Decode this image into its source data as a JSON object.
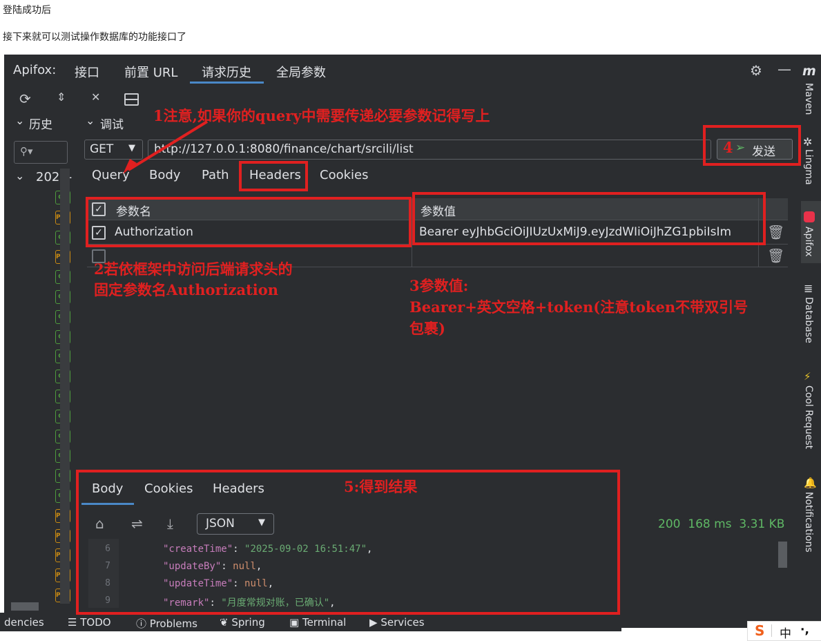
{
  "doc": {
    "line1": "登陆成功后",
    "line2": "接下来就可以测试操作数据库的功能接口了"
  },
  "header": {
    "app_label": "Apifox:",
    "tabs": [
      "接口",
      "前置 URL",
      "请求历史",
      "全局参数"
    ]
  },
  "left_panel": {
    "history_label": "历史",
    "year_label": "2025-",
    "tags": [
      "GE",
      "POS",
      "GE",
      "POS",
      "GE",
      "GE",
      "GE",
      "GE",
      "GE",
      "GE",
      "GE",
      "GE",
      "GE",
      "GE",
      "GE",
      "GE",
      "POS",
      "POS",
      "POS",
      "POS",
      "POS"
    ]
  },
  "debug": {
    "label": "调试",
    "method": "GET",
    "url": "http://127.0.0.1:8080/finance/chart/srcili/list",
    "send_label": "发送",
    "tabs": [
      "Query",
      "Body",
      "Path",
      "Headers",
      "Cookies"
    ]
  },
  "headers_table": {
    "col_name": "参数名",
    "col_value": "参数值",
    "rows": [
      {
        "name": "Authorization",
        "value": "Bearer eyJhbGciOiJIUzUxMiJ9.eyJzdWIiOiJhZG1pbiIsIm",
        "checked": true
      },
      {
        "name": "",
        "value": "",
        "checked": false
      }
    ]
  },
  "response": {
    "tabs": [
      "Body",
      "Cookies",
      "Headers"
    ],
    "format": "JSON",
    "status": "200",
    "time": "168 ms",
    "size": "3.31 KB",
    "lines": [
      {
        "num": "6",
        "key": "\"createTime\"",
        "sep": ": ",
        "value": "\"2025-09-02 16:51:47\"",
        "tail": ","
      },
      {
        "num": "7",
        "key": "\"updateBy\"",
        "sep": ": ",
        "value": "null",
        "tail": ","
      },
      {
        "num": "8",
        "key": "\"updateTime\"",
        "sep": ": ",
        "value": "null",
        "tail": ","
      },
      {
        "num": "9",
        "key": "\"remark\"",
        "sep": ": ",
        "value": "\"月度常规对账，已确认\"",
        "tail": ","
      }
    ]
  },
  "right_sidebar": [
    "Maven",
    "Lingma",
    "Apifox",
    "Database",
    "Cool Request",
    "Notifications"
  ],
  "status_bar": {
    "left_cut": "dencies",
    "items": [
      "TODO",
      "Problems",
      "Spring",
      "Terminal",
      "Services"
    ]
  },
  "ime": {
    "logo": "S",
    "lang": "中",
    "punct": "·,"
  },
  "annotations": {
    "note1": "1注意,如果你的query中需要传递必要参数记得写上",
    "note2_line1": "2若依框架中访问后端请求头的",
    "note2_line2": "固定参数名Authorization",
    "note3_line1": "3参数值:",
    "note3_line2": "Bearer+英文空格+token(注意token不带双引号",
    "note3_line3": "包裹)",
    "note4": "4",
    "note5": "5:得到结果"
  },
  "colors": {
    "annotation_red": "#e02020",
    "status_green": "#5fb865",
    "json_key": "#c77dbb",
    "json_string": "#6aab73",
    "json_null": "#cf8e6d"
  }
}
